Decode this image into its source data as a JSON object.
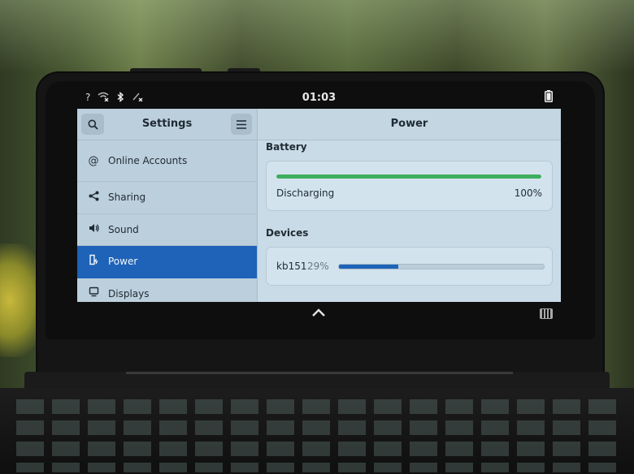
{
  "status_bar": {
    "time": "01:03",
    "left_icons": [
      "?",
      "wifi-off-icon",
      "bluetooth-icon",
      "network-off-icon"
    ],
    "battery_icon": "battery-full-icon"
  },
  "sidebar": {
    "title": "Settings",
    "search_icon": "search-icon",
    "menu_icon": "menu-icon",
    "items": [
      {
        "label": "Online Accounts",
        "icon": "@"
      },
      {
        "label": "Sharing",
        "icon": "share-icon"
      },
      {
        "label": "Sound",
        "icon": "speaker-icon"
      },
      {
        "label": "Power",
        "icon": "power-icon",
        "active": true
      },
      {
        "label": "Displays",
        "icon": "display-icon"
      }
    ]
  },
  "main": {
    "title": "Power",
    "battery": {
      "section_title": "Battery",
      "status": "Discharging",
      "percent_label": "100%",
      "level": 1.0
    },
    "devices": {
      "section_title": "Devices",
      "items": [
        {
          "name": "kb151",
          "percent_label": "29%",
          "level": 0.29
        }
      ]
    }
  },
  "navbar": {
    "up_icon": "chevron-up-icon",
    "keyboard_icon": "keyboard-icon"
  },
  "colors": {
    "accent": "#1e63b8",
    "battery_bar": "#3fae5c"
  }
}
